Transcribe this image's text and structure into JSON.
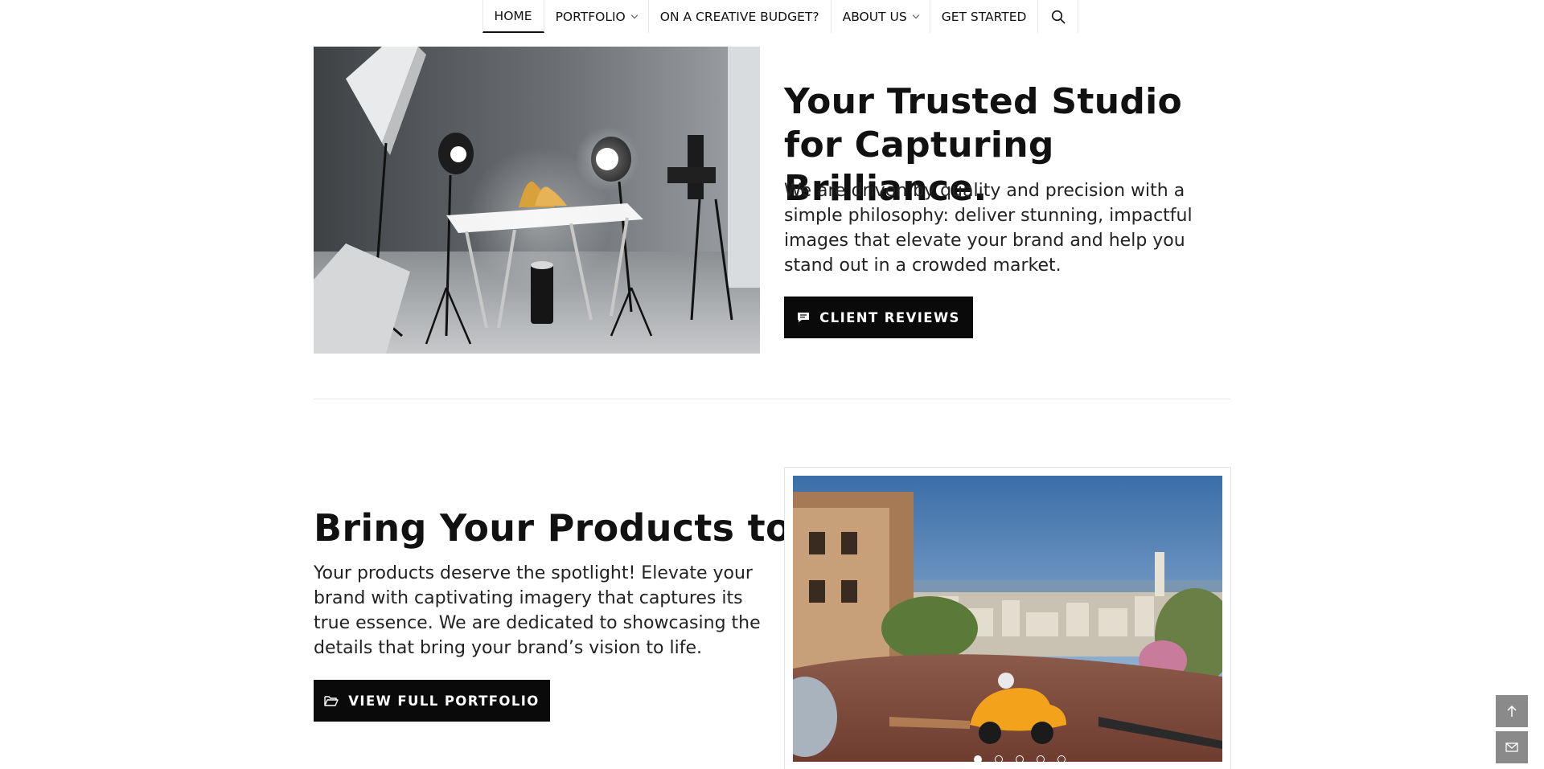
{
  "nav": {
    "items": [
      {
        "label": "HOME",
        "active": true,
        "dropdown": false
      },
      {
        "label": "PORTFOLIO",
        "active": false,
        "dropdown": true
      },
      {
        "label": "ON A CREATIVE BUDGET?",
        "active": false,
        "dropdown": false
      },
      {
        "label": "ABOUT US",
        "active": false,
        "dropdown": true
      },
      {
        "label": "GET STARTED",
        "active": false,
        "dropdown": false
      }
    ],
    "search_icon": "search-icon"
  },
  "studio": {
    "title": "Your Trusted Studio for Capturing Brilliance.",
    "text": "We are driven by quality and precision with a simple philosophy: deliver stunning, impactful images that elevate your brand and help you stand out in a crowded market.",
    "button_label": "CLIENT REVIEWS",
    "button_icon": "chat-bubble-icon",
    "image_subject": "photo-studio-with-lights"
  },
  "products": {
    "title": "Bring Your Products to Life.",
    "text": "Your products deserve the spotlight! Elevate your brand with captivating imagery that captures its true essence. We are dedicated to showcasing the details that bring your brand’s vision to life.",
    "button_label": "VIEW FULL PORTFOLIO",
    "button_icon": "folder-open-icon"
  },
  "slider": {
    "slide_count": 5,
    "active_slide": 1,
    "image_subject": "orange-gocar-on-lombard-street"
  },
  "floating": {
    "top_icon": "arrow-up-icon",
    "mail_icon": "mail-icon"
  },
  "colors": {
    "button_bg": "#0a0a0a",
    "button_text": "#ffffff",
    "floating_bg": "#8a8a8a",
    "text": "#111111"
  }
}
